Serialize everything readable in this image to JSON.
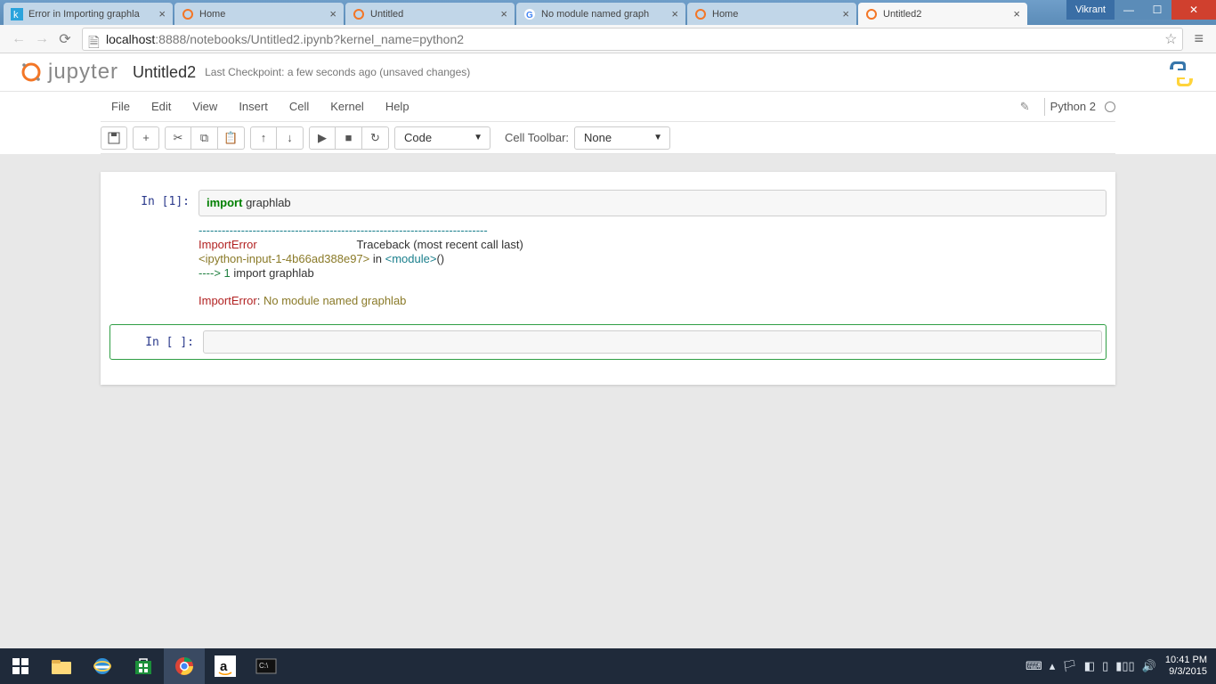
{
  "browser": {
    "user_chip": "Vikrant",
    "tabs": [
      {
        "title": "Error in Importing graphla",
        "active": false,
        "icon": "k"
      },
      {
        "title": "Home",
        "active": false,
        "icon": "jup"
      },
      {
        "title": "Untitled",
        "active": false,
        "icon": "jup"
      },
      {
        "title": "No module named graph",
        "active": false,
        "icon": "g"
      },
      {
        "title": "Home",
        "active": false,
        "icon": "jup"
      },
      {
        "title": "Untitled2",
        "active": true,
        "icon": "jup"
      }
    ],
    "url_host": "localhost",
    "url_rest": ":8888/notebooks/Untitled2.ipynb?kernel_name=python2"
  },
  "notebook": {
    "logo_word": "jupyter",
    "title": "Untitled2",
    "checkpoint": "Last Checkpoint: a few seconds ago (unsaved changes)",
    "menus": [
      "File",
      "Edit",
      "View",
      "Insert",
      "Cell",
      "Kernel",
      "Help"
    ],
    "kernel_name": "Python 2",
    "celltype_value": "Code",
    "celltoolbar_label": "Cell Toolbar:",
    "celltoolbar_value": "None"
  },
  "cells": {
    "in1_prompt": "In [1]:",
    "in1_kw": "import",
    "in1_nm": " graphlab",
    "out_dashes": "---------------------------------------------------------------------------",
    "out_l1a": "ImportError",
    "out_l1b": "                               Traceback (most recent call last)",
    "out_l2a": "<ipython-input-1-4b66ad388e97>",
    "out_l2b": " in ",
    "out_l2c": "<module>",
    "out_l2d": "()",
    "out_l3a": "----> 1",
    "out_l3b": " import ",
    "out_l3c": "graphlab",
    "out_l5a": "ImportError",
    "out_l5b": ": ",
    "out_l5c": "No module named graphlab",
    "in_empty_prompt": "In [ ]:"
  },
  "system": {
    "time": "10:41 PM",
    "date": "9/3/2015"
  }
}
